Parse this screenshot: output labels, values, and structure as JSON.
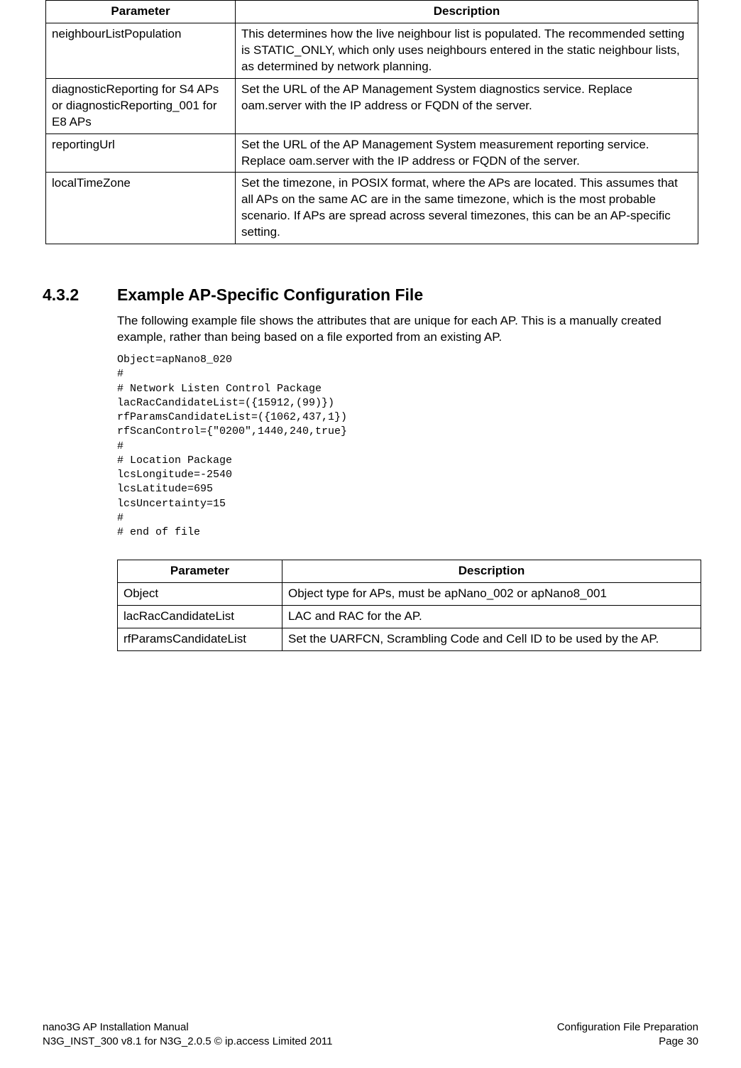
{
  "table1": {
    "headers": [
      "Parameter",
      "Description"
    ],
    "rows": [
      {
        "param": "neighbourListPopulation",
        "desc": "This determines how the live neighbour list is populated. The recommended setting is STATIC_ONLY, which only uses neighbours entered in the static neighbour lists, as determined by network planning."
      },
      {
        "param": "diagnosticReporting for S4 APs or diagnosticReporting_001 for E8 APs",
        "desc": "Set the URL of the AP Management System diagnostics service. Replace oam.server with the IP address or FQDN of the server."
      },
      {
        "param": "reportingUrl",
        "desc": "Set the URL of the AP Management System measurement reporting service. Replace oam.server with the IP address or FQDN of the server."
      },
      {
        "param": "localTimeZone",
        "desc": "Set the timezone, in POSIX format, where the APs are located. This assumes that all APs on the same AC are in the same timezone, which is the most probable scenario. If APs are spread across several timezones, this can be an AP-specific setting."
      }
    ]
  },
  "section": {
    "number": "4.3.2",
    "title": "Example AP-Specific Configuration File",
    "body": "The following example file shows the attributes that are unique for each AP. This is a manually created example, rather than being based on a file exported from an existing AP."
  },
  "code": "Object=apNano8_020\n#\n# Network Listen Control Package\nlacRacCandidateList=({15912,(99)})\nrfParamsCandidateList=({1062,437,1})\nrfScanControl={\"0200\",1440,240,true}\n#\n# Location Package\nlcsLongitude=-2540\nlcsLatitude=695\nlcsUncertainty=15\n#\n# end of file",
  "table2": {
    "headers": [
      "Parameter",
      "Description"
    ],
    "rows": [
      {
        "param": "Object",
        "desc": "Object type for APs, must be apNano_002 or apNano8_001"
      },
      {
        "param": "lacRacCandidateList",
        "desc": "LAC and RAC for the AP."
      },
      {
        "param": "rfParamsCandidateList",
        "desc": "Set the UARFCN, Scrambling Code and Cell ID to be used by the AP."
      }
    ]
  },
  "footer": {
    "left1": "nano3G AP Installation Manual",
    "right1": "Configuration File Preparation",
    "left2": "N3G_INST_300 v8.1 for N3G_2.0.5 © ip.access Limited 2011",
    "right2": "Page 30"
  }
}
